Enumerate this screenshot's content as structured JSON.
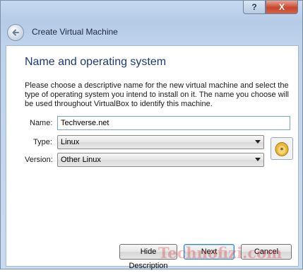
{
  "window": {
    "help_glyph": "?",
    "close_glyph": "X",
    "title": "Create Virtual Machine"
  },
  "page": {
    "heading": "Name and operating system",
    "description": "Please choose a descriptive name for the new virtual machine and select the type of operating system you intend to install on it. The name you choose will be used throughout VirtualBox to identify this machine."
  },
  "fields": {
    "name_label": "Name:",
    "name_value": "Techverse.net",
    "type_label": "Type:",
    "type_value": "Linux",
    "version_label": "Version:",
    "version_value": "Other Linux",
    "os_icon": "linux-tux-icon"
  },
  "buttons": {
    "hide_description": "Hide Description",
    "next": "Next",
    "cancel": "Cancel"
  },
  "watermark": "Technofizi.com",
  "colors": {
    "heading": "#1b3a78",
    "close_button": "#c7452c",
    "watermark": "#d63c46"
  }
}
